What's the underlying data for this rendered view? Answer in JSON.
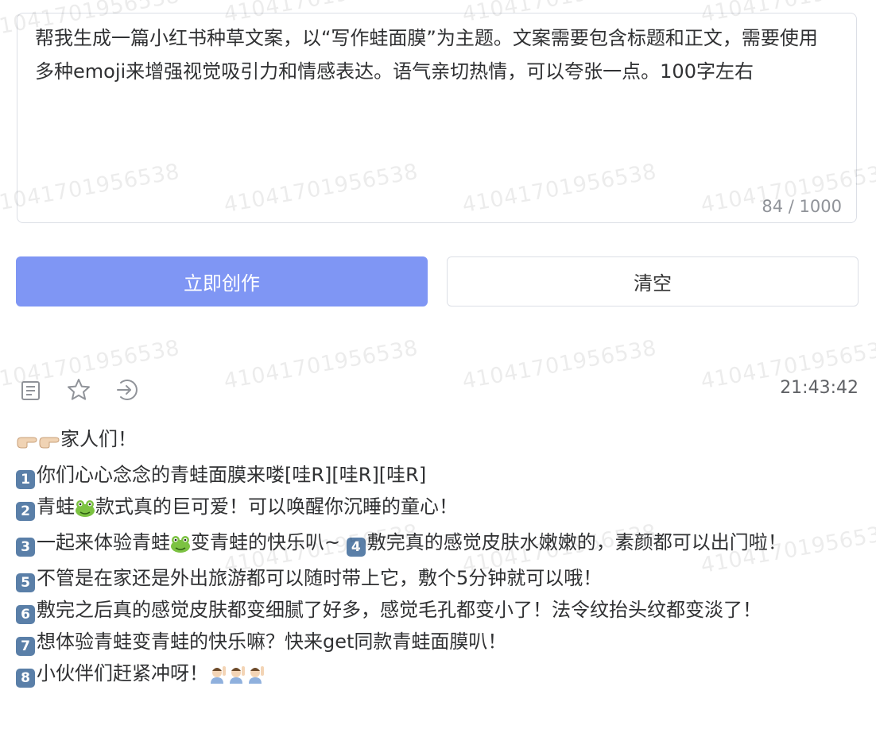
{
  "prompt": {
    "text": "帮我生成一篇小红书种草文案，以“写作蛙面膜”为主题。文案需要包含标题和正文，需要使用多种emoji来增强视觉吸引力和情感表达。语气亲切热情，可以夸张一点。100字左右",
    "char_count": "84 / 1000"
  },
  "buttons": {
    "create_label": "立即创作",
    "clear_label": "清空"
  },
  "result_toolbar": {
    "icons": [
      "document-icon",
      "star-icon",
      "export-icon"
    ],
    "timestamp": "21:43:42"
  },
  "result": {
    "greeting": "家人们！",
    "line1": "你们心心念念的青蛙面膜来喽[哇R][哇R][哇R]",
    "line2a": "青蛙",
    "line2b": "款式真的巨可爱！可以唤醒你沉睡的童心！",
    "line3a": "一起来体验青蛙",
    "line3b": "变青蛙的快乐叭~ ",
    "line4": "敷完真的感觉皮肤水嫩嫩的，素颜都可以出门啦！",
    "line5": "不管是在家还是外出旅游都可以随时带上它，敷个5分钟就可以哦！",
    "line6": "敷完之后真的感觉皮肤都变细腻了好多，感觉毛孔都变小了！法令纹抬头纹都变淡了！",
    "line7": "想体验青蛙变青蛙的快乐嘛？快来get同款青蛙面膜叭！",
    "line8": "小伙伴们赶紧冲呀！"
  },
  "watermark_text": "41041701956538",
  "colors": {
    "primary_button": "#7f96f4",
    "border": "#dcdfe6",
    "keycap": "#5a7fa8"
  }
}
